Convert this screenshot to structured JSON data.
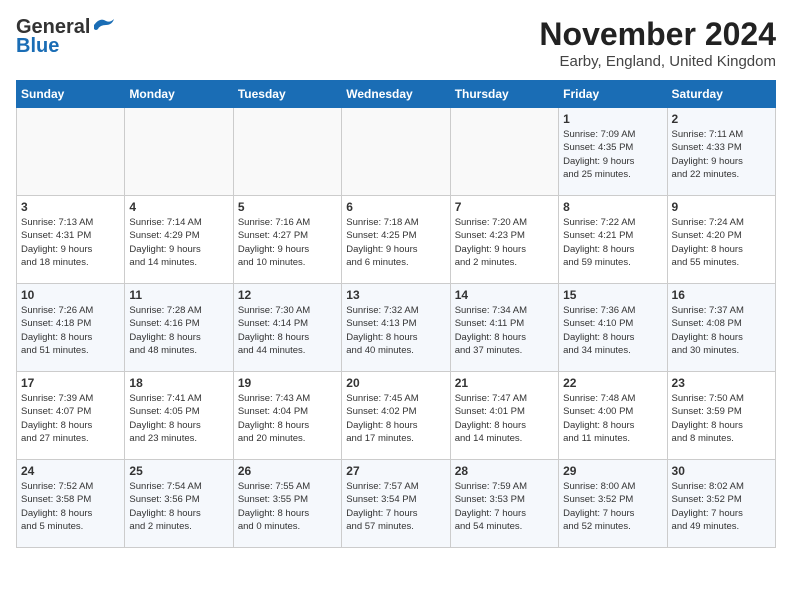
{
  "header": {
    "logo_general": "General",
    "logo_blue": "Blue",
    "month_title": "November 2024",
    "location": "Earby, England, United Kingdom"
  },
  "weekdays": [
    "Sunday",
    "Monday",
    "Tuesday",
    "Wednesday",
    "Thursday",
    "Friday",
    "Saturday"
  ],
  "weeks": [
    [
      {
        "day": "",
        "info": ""
      },
      {
        "day": "",
        "info": ""
      },
      {
        "day": "",
        "info": ""
      },
      {
        "day": "",
        "info": ""
      },
      {
        "day": "",
        "info": ""
      },
      {
        "day": "1",
        "info": "Sunrise: 7:09 AM\nSunset: 4:35 PM\nDaylight: 9 hours\nand 25 minutes."
      },
      {
        "day": "2",
        "info": "Sunrise: 7:11 AM\nSunset: 4:33 PM\nDaylight: 9 hours\nand 22 minutes."
      }
    ],
    [
      {
        "day": "3",
        "info": "Sunrise: 7:13 AM\nSunset: 4:31 PM\nDaylight: 9 hours\nand 18 minutes."
      },
      {
        "day": "4",
        "info": "Sunrise: 7:14 AM\nSunset: 4:29 PM\nDaylight: 9 hours\nand 14 minutes."
      },
      {
        "day": "5",
        "info": "Sunrise: 7:16 AM\nSunset: 4:27 PM\nDaylight: 9 hours\nand 10 minutes."
      },
      {
        "day": "6",
        "info": "Sunrise: 7:18 AM\nSunset: 4:25 PM\nDaylight: 9 hours\nand 6 minutes."
      },
      {
        "day": "7",
        "info": "Sunrise: 7:20 AM\nSunset: 4:23 PM\nDaylight: 9 hours\nand 2 minutes."
      },
      {
        "day": "8",
        "info": "Sunrise: 7:22 AM\nSunset: 4:21 PM\nDaylight: 8 hours\nand 59 minutes."
      },
      {
        "day": "9",
        "info": "Sunrise: 7:24 AM\nSunset: 4:20 PM\nDaylight: 8 hours\nand 55 minutes."
      }
    ],
    [
      {
        "day": "10",
        "info": "Sunrise: 7:26 AM\nSunset: 4:18 PM\nDaylight: 8 hours\nand 51 minutes."
      },
      {
        "day": "11",
        "info": "Sunrise: 7:28 AM\nSunset: 4:16 PM\nDaylight: 8 hours\nand 48 minutes."
      },
      {
        "day": "12",
        "info": "Sunrise: 7:30 AM\nSunset: 4:14 PM\nDaylight: 8 hours\nand 44 minutes."
      },
      {
        "day": "13",
        "info": "Sunrise: 7:32 AM\nSunset: 4:13 PM\nDaylight: 8 hours\nand 40 minutes."
      },
      {
        "day": "14",
        "info": "Sunrise: 7:34 AM\nSunset: 4:11 PM\nDaylight: 8 hours\nand 37 minutes."
      },
      {
        "day": "15",
        "info": "Sunrise: 7:36 AM\nSunset: 4:10 PM\nDaylight: 8 hours\nand 34 minutes."
      },
      {
        "day": "16",
        "info": "Sunrise: 7:37 AM\nSunset: 4:08 PM\nDaylight: 8 hours\nand 30 minutes."
      }
    ],
    [
      {
        "day": "17",
        "info": "Sunrise: 7:39 AM\nSunset: 4:07 PM\nDaylight: 8 hours\nand 27 minutes."
      },
      {
        "day": "18",
        "info": "Sunrise: 7:41 AM\nSunset: 4:05 PM\nDaylight: 8 hours\nand 23 minutes."
      },
      {
        "day": "19",
        "info": "Sunrise: 7:43 AM\nSunset: 4:04 PM\nDaylight: 8 hours\nand 20 minutes."
      },
      {
        "day": "20",
        "info": "Sunrise: 7:45 AM\nSunset: 4:02 PM\nDaylight: 8 hours\nand 17 minutes."
      },
      {
        "day": "21",
        "info": "Sunrise: 7:47 AM\nSunset: 4:01 PM\nDaylight: 8 hours\nand 14 minutes."
      },
      {
        "day": "22",
        "info": "Sunrise: 7:48 AM\nSunset: 4:00 PM\nDaylight: 8 hours\nand 11 minutes."
      },
      {
        "day": "23",
        "info": "Sunrise: 7:50 AM\nSunset: 3:59 PM\nDaylight: 8 hours\nand 8 minutes."
      }
    ],
    [
      {
        "day": "24",
        "info": "Sunrise: 7:52 AM\nSunset: 3:58 PM\nDaylight: 8 hours\nand 5 minutes."
      },
      {
        "day": "25",
        "info": "Sunrise: 7:54 AM\nSunset: 3:56 PM\nDaylight: 8 hours\nand 2 minutes."
      },
      {
        "day": "26",
        "info": "Sunrise: 7:55 AM\nSunset: 3:55 PM\nDaylight: 8 hours\nand 0 minutes."
      },
      {
        "day": "27",
        "info": "Sunrise: 7:57 AM\nSunset: 3:54 PM\nDaylight: 7 hours\nand 57 minutes."
      },
      {
        "day": "28",
        "info": "Sunrise: 7:59 AM\nSunset: 3:53 PM\nDaylight: 7 hours\nand 54 minutes."
      },
      {
        "day": "29",
        "info": "Sunrise: 8:00 AM\nSunset: 3:52 PM\nDaylight: 7 hours\nand 52 minutes."
      },
      {
        "day": "30",
        "info": "Sunrise: 8:02 AM\nSunset: 3:52 PM\nDaylight: 7 hours\nand 49 minutes."
      }
    ]
  ]
}
